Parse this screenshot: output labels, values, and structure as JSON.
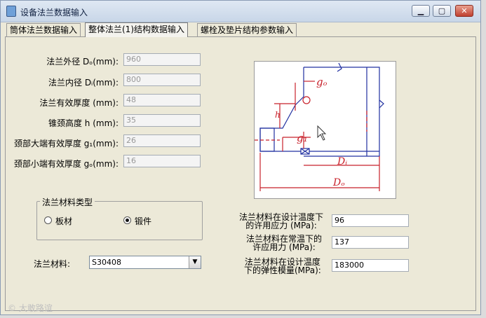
{
  "window": {
    "title": "设备法兰数据输入",
    "min_glyph": "▁",
    "max_glyph": "▢",
    "close_glyph": "✕"
  },
  "tabs": [
    {
      "label": "筒体法兰数据输入"
    },
    {
      "label": "整体法兰(1)结构数据输入"
    },
    {
      "label": "螺栓及垫片结构参数输入"
    }
  ],
  "fields": [
    {
      "label": "法兰外径 Dₒ(mm):",
      "value": "960"
    },
    {
      "label": "法兰内径 Dᵢ(mm):",
      "value": "800"
    },
    {
      "label": "法兰有效厚度 (mm):",
      "value": "48"
    },
    {
      "label": "锥颈高度 h (mm):",
      "value": "35"
    },
    {
      "label": "颈部大端有效厚度 g₁(mm):",
      "value": "26"
    },
    {
      "label": "颈部小端有效厚度 gₒ(mm):",
      "value": "16"
    }
  ],
  "material_type": {
    "title": "法兰材料类型",
    "options": [
      "板材",
      "锻件"
    ],
    "selected": "锻件"
  },
  "material": {
    "label": "法兰材料:",
    "value": "S30408",
    "arrow": "▼"
  },
  "stress": [
    {
      "label1": "法兰材料在设计温度下",
      "label2": "的许用应力 (MPa):",
      "value": "96"
    },
    {
      "label1": "法兰材料在常温下的",
      "label2": "许应用力 (MPa):",
      "value": "137"
    },
    {
      "label1": "法兰材料在设计温度",
      "label2": "下的弹性模量(MPa):",
      "value": "183000"
    }
  ],
  "figure": {
    "g0": "gₒ",
    "g1": "g₁",
    "h": "h",
    "Di": "Dᵢ",
    "Do": "Dₒ"
  },
  "watermark": "© 大敢路谊",
  "colors": {
    "drawing_red": "#c8202a",
    "drawing_blue": "#2030a0"
  }
}
